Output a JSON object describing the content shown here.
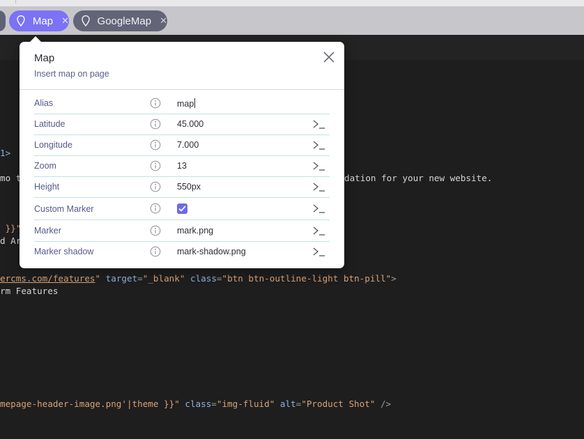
{
  "tabs": {
    "items": [
      {
        "label": "Map",
        "state": "active",
        "icon": "map-pin-icon",
        "close_icon": "close-icon"
      },
      {
        "label": "GoogleMap",
        "state": "inactive",
        "icon": "map-pin-icon",
        "close_icon": "close-icon"
      }
    ]
  },
  "popup": {
    "title": "Map",
    "subtitle": "Insert map on page",
    "close_icon": "close-icon",
    "fields": [
      {
        "label": "Alias",
        "value": "map",
        "info_icon": "info-icon",
        "focused": true
      },
      {
        "label": "Latitude",
        "value": "45.000",
        "info_icon": "info-icon",
        "action_icon": "terminal-icon"
      },
      {
        "label": "Longitude",
        "value": "7.000",
        "info_icon": "info-icon",
        "action_icon": "terminal-icon"
      },
      {
        "label": "Zoom",
        "value": "13",
        "info_icon": "info-icon",
        "action_icon": "terminal-icon"
      },
      {
        "label": "Height",
        "value": "550px",
        "info_icon": "info-icon",
        "action_icon": "terminal-icon"
      },
      {
        "label": "Custom Marker",
        "checked": true,
        "info_icon": "info-icon",
        "action_icon": "terminal-icon"
      },
      {
        "label": "Marker",
        "value": "mark.png",
        "info_icon": "info-icon",
        "action_icon": "terminal-icon"
      },
      {
        "label": "Marker shadow",
        "value": "mark-shadow.png",
        "info_icon": "info-icon",
        "action_icon": "terminal-icon"
      }
    ]
  },
  "code": {
    "lines": [
      {
        "id": "l1",
        "parts": [
          "1>"
        ]
      },
      {
        "id": "l2",
        "parts": [
          "mo t",
          "dation for your new website."
        ]
      },
      {
        "id": "l3",
        "parts": [
          " }}\""
        ]
      },
      {
        "id": "l4",
        "parts": [
          "d Ar"
        ]
      },
      {
        "id": "l5",
        "parts": [
          "ercms.com/features",
          "\"",
          " target",
          "=",
          "\"_blank\"",
          " class",
          "=",
          "\"btn btn-outline-light btn-pill\"",
          ">"
        ]
      },
      {
        "id": "l6",
        "parts": [
          "rm Features"
        ]
      },
      {
        "id": "l7",
        "parts": [
          "mepage-header-image.png'|theme }}\"",
          " class",
          "=",
          "\"img-fluid\"",
          " alt",
          "=",
          "\"Product Shot\"",
          " />"
        ]
      }
    ]
  },
  "colors": {
    "accent": "#7a73f5",
    "inactive_tab": "#626477",
    "row_divider": "#c3e3df",
    "label": "#55598a"
  }
}
